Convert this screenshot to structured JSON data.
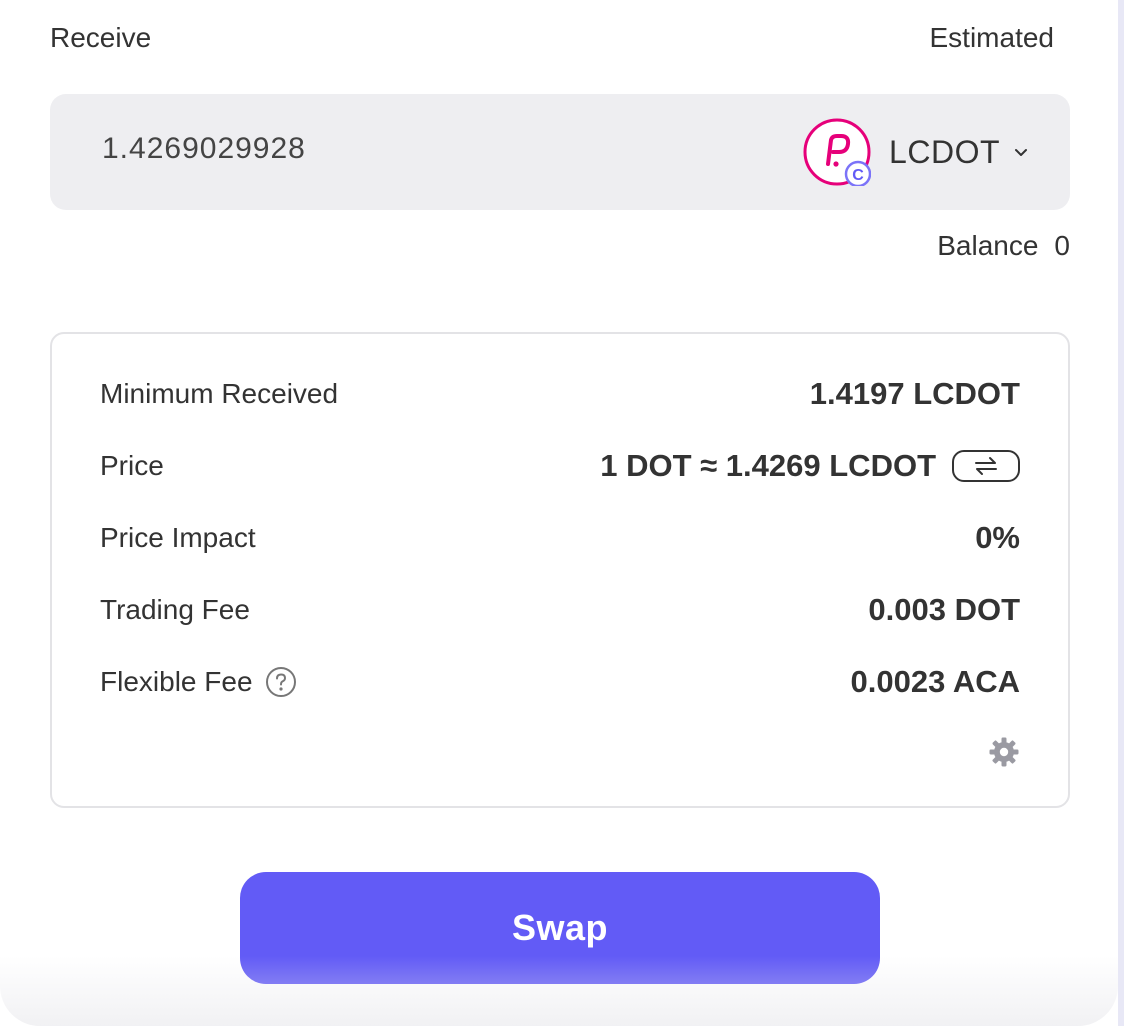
{
  "receive": {
    "label": "Receive",
    "estimated_label": "Estimated",
    "amount": "1.4269029928",
    "token": {
      "symbol": "LCDOT",
      "icon": "polkadot-lcdot-icon",
      "badge_letter": "C",
      "color": "#e6007a"
    },
    "balance_label": "Balance",
    "balance_value": "0"
  },
  "details": {
    "rows": [
      {
        "label": "Minimum Received",
        "value": "1.4197 LCDOT"
      },
      {
        "label": "Price",
        "value": "1 DOT ≈ 1.4269 LCDOT",
        "action_icon": "swap-direction-icon"
      },
      {
        "label": "Price Impact",
        "value": "0%"
      },
      {
        "label": "Trading Fee",
        "value": "0.003 DOT"
      },
      {
        "label": "Flexible Fee",
        "value": "0.0023 ACA",
        "info_icon": "question-circle-icon"
      }
    ],
    "settings_icon": "gear-icon"
  },
  "actions": {
    "swap_label": "Swap",
    "accent_color": "#625bf6"
  }
}
